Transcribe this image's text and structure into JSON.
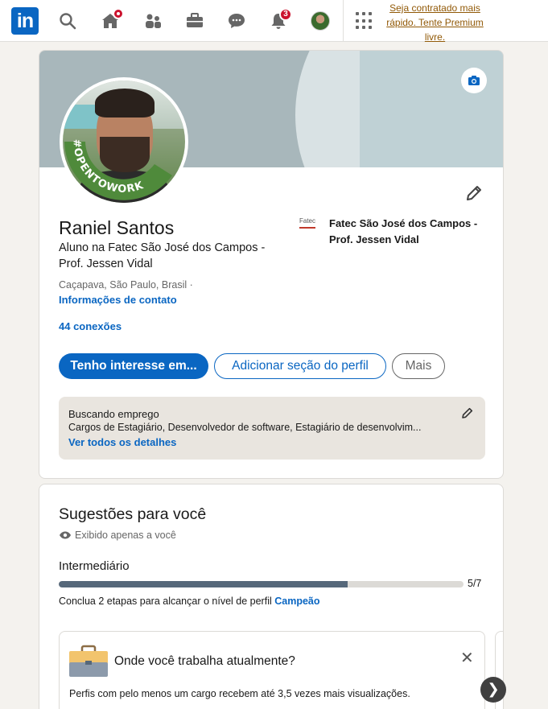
{
  "nav": {
    "logo_text": "in",
    "icons": [
      "search-icon",
      "home-icon",
      "network-icon",
      "jobs-icon",
      "messaging-icon",
      "notifications-icon",
      "profile-icon",
      "apps-icon"
    ],
    "notifications_count": "3",
    "premium_text": "Seja contratado mais rápido. Tente Premium livre."
  },
  "profile": {
    "name": "Raniel Santos",
    "headline": "Aluno na Fatec São José dos Campos - Prof. Jessen Vidal",
    "location": "Caçapava, São Paulo, Brasil ·",
    "contact_link": "Informações de contato",
    "connections": "44 conexões",
    "open_to_work_badge": "#OPENTOWORK",
    "school_logo_text": "Fatec",
    "school_name": "Fatec São José dos Campos - Prof. Jessen Vidal",
    "buttons": {
      "interest": "Tenho interesse em...",
      "add_section": "Adicionar seção do perfil",
      "more": "Mais"
    },
    "open_to_work": {
      "title": "Buscando emprego",
      "description": "Cargos de Estagiário, Desenvolvedor de software, Estagiário de desenvolvim...",
      "link": "Ver todos os detalhes"
    }
  },
  "suggestions": {
    "title": "Sugestões para você",
    "private_note": "Exibido apenas a você",
    "level": "Intermediário",
    "progress_fraction": 0.714,
    "progress_label": "5/7",
    "progress_desc_prefix": "Conclua 2 etapas para alcançar o nível de perfil ",
    "progress_desc_level": "Campeão",
    "task": {
      "title": "Onde você trabalha atualmente?",
      "description": "Perfis com pelo menos um cargo recebem até 3,5 vezes mais visualizações.",
      "close_glyph": "✕"
    },
    "next_glyph": "❯"
  },
  "colors": {
    "brand": "#0a66c2",
    "badge": "#cb112d",
    "premium": "#915907",
    "open_to_work_green": "#4f8a3b"
  }
}
